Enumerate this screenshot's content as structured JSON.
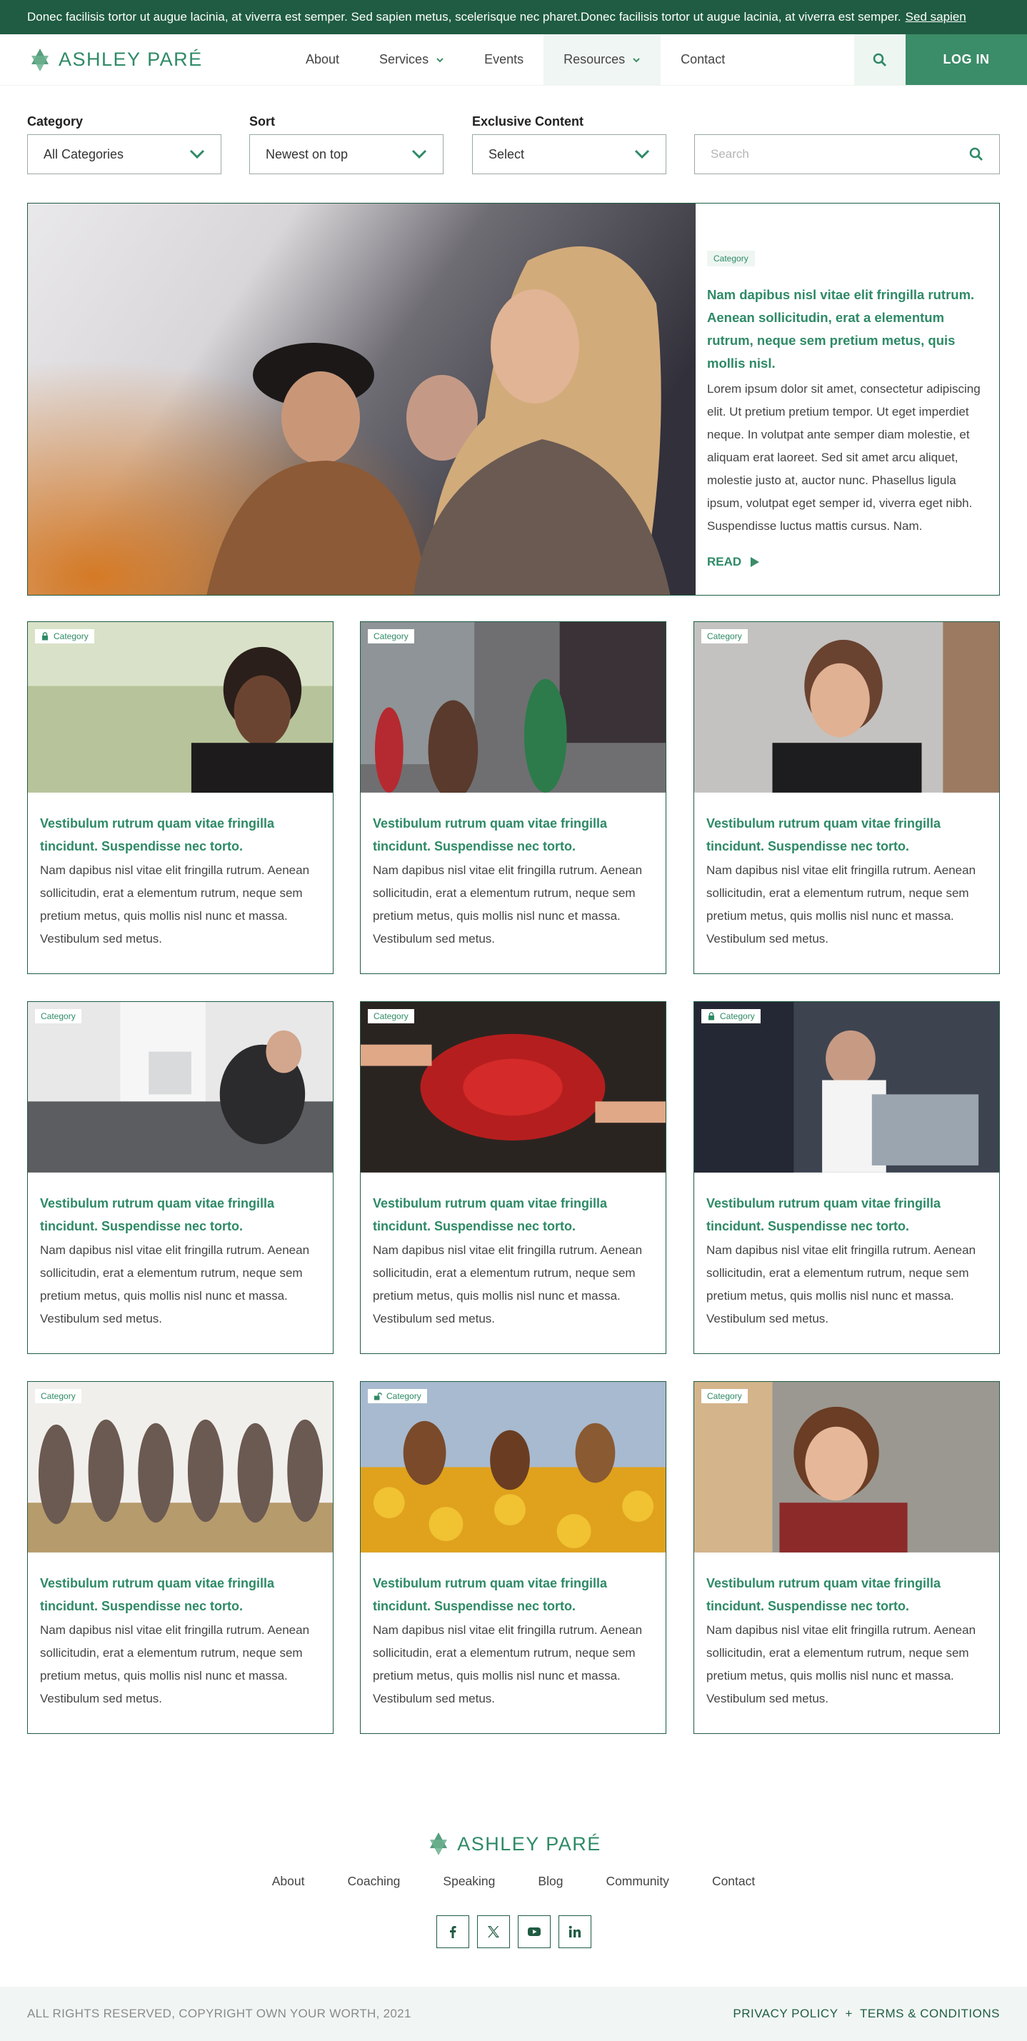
{
  "announcement": {
    "text": "Donec facilisis tortor ut augue lacinia, at viverra est semper. Sed sapien metus, scelerisque nec pharet.Donec facilisis tortor ut augue lacinia, at viverra est semper.",
    "link": "Sed sapien"
  },
  "brand": {
    "name": "ASHLEY PARÉ"
  },
  "nav": {
    "items": [
      {
        "label": "About"
      },
      {
        "label": "Services"
      },
      {
        "label": "Events"
      },
      {
        "label": "Resources"
      },
      {
        "label": "Contact"
      }
    ],
    "login": "LOG IN"
  },
  "filters": {
    "category": {
      "label": "Category",
      "value": "All Categories"
    },
    "sort": {
      "label": "Sort",
      "value": "Newest on top"
    },
    "exclusive": {
      "label": "Exclusive Content",
      "value": "Select"
    },
    "search": {
      "placeholder": "Search"
    }
  },
  "featured": {
    "tag": "Category",
    "title": "Nam dapibus nisl vitae elit fringilla rutrum. Aenean sollicitudin, erat a elementum rutrum, neque sem pretium metus, quis mollis nisl.",
    "text": "Lorem ipsum dolor sit amet, consectetur adipiscing elit. Ut pretium pretium tempor. Ut eget imperdiet neque. In volutpat ante semper diam molestie, et aliquam erat laoreet. Sed sit amet arcu aliquet, molestie justo at, auctor nunc. Phasellus ligula ipsum, volutpat eget semper id, viverra eget nibh. Suspendisse luctus mattis cursus. Nam.",
    "read": "READ"
  },
  "cards": [
    {
      "tag": "Category",
      "icon": "lock-icon",
      "title": "Vestibulum rutrum quam vitae fringilla tincidunt. Suspendisse nec torto.",
      "text": "Nam dapibus nisl vitae elit fringilla rutrum. Aenean sollicitudin, erat a elementum rutrum, neque sem pretium metus, quis mollis nisl nunc et massa. Vestibulum sed metus."
    },
    {
      "tag": "Category",
      "icon": "",
      "title": "Vestibulum rutrum quam vitae fringilla tincidunt. Suspendisse nec torto.",
      "text": "Nam dapibus nisl vitae elit fringilla rutrum. Aenean sollicitudin, erat a elementum rutrum, neque sem pretium metus, quis mollis nisl nunc et massa. Vestibulum sed metus."
    },
    {
      "tag": "Category",
      "icon": "",
      "title": "Vestibulum rutrum quam vitae fringilla tincidunt. Suspendisse nec torto.",
      "text": "Nam dapibus nisl vitae elit fringilla rutrum. Aenean sollicitudin, erat a elementum rutrum, neque sem pretium metus, quis mollis nisl nunc et massa. Vestibulum sed metus."
    },
    {
      "tag": "Category",
      "icon": "",
      "title": "Vestibulum rutrum quam vitae fringilla tincidunt. Suspendisse nec torto.",
      "text": "Nam dapibus nisl vitae elit fringilla rutrum. Aenean sollicitudin, erat a elementum rutrum, neque sem pretium metus, quis mollis nisl nunc et massa. Vestibulum sed metus."
    },
    {
      "tag": "Category",
      "icon": "",
      "title": "Vestibulum rutrum quam vitae fringilla tincidunt. Suspendisse nec torto.",
      "text": "Nam dapibus nisl vitae elit fringilla rutrum. Aenean sollicitudin, erat a elementum rutrum, neque sem pretium metus, quis mollis nisl nunc et massa. Vestibulum sed metus."
    },
    {
      "tag": "Category",
      "icon": "lock-icon",
      "title": "Vestibulum rutrum quam vitae fringilla tincidunt. Suspendisse nec torto.",
      "text": "Nam dapibus nisl vitae elit fringilla rutrum. Aenean sollicitudin, erat a elementum rutrum, neque sem pretium metus, quis mollis nisl nunc et massa. Vestibulum sed metus."
    },
    {
      "tag": "Category",
      "icon": "",
      "title": "Vestibulum rutrum quam vitae fringilla tincidunt. Suspendisse nec torto.",
      "text": "Nam dapibus nisl vitae elit fringilla rutrum. Aenean sollicitudin, erat a elementum rutrum, neque sem pretium metus, quis mollis nisl nunc et massa. Vestibulum sed metus."
    },
    {
      "tag": "Category",
      "icon": "unlock-icon",
      "title": "Vestibulum rutrum quam vitae fringilla tincidunt. Suspendisse nec torto.",
      "text": "Nam dapibus nisl vitae elit fringilla rutrum. Aenean sollicitudin, erat a elementum rutrum, neque sem pretium metus, quis mollis nisl nunc et massa. Vestibulum sed metus."
    },
    {
      "tag": "Category",
      "icon": "",
      "title": "Vestibulum rutrum quam vitae fringilla tincidunt. Suspendisse nec torto.",
      "text": "Nam dapibus nisl vitae elit fringilla rutrum. Aenean sollicitudin, erat a elementum rutrum, neque sem pretium metus, quis mollis nisl nunc et massa. Vestibulum sed metus."
    }
  ],
  "footer": {
    "nav": [
      {
        "label": "About"
      },
      {
        "label": "Coaching"
      },
      {
        "label": "Speaking"
      },
      {
        "label": "Blog"
      },
      {
        "label": "Community"
      },
      {
        "label": "Contact"
      }
    ],
    "socials": [
      "facebook-icon",
      "x-icon",
      "youtube-icon",
      "linkedin-icon"
    ],
    "copyright": "ALL RIGHTS RESERVED, COPYRIGHT OWN YOUR WORTH, 2021",
    "privacy": "PRIVACY POLICY",
    "separator": "+",
    "terms": "TERMS & CONDITIONS"
  },
  "colors": {
    "brand_dark": "#1f5c43",
    "brand": "#2e8a66",
    "brand_button": "#3b8c68",
    "tint": "#eef6f2"
  }
}
